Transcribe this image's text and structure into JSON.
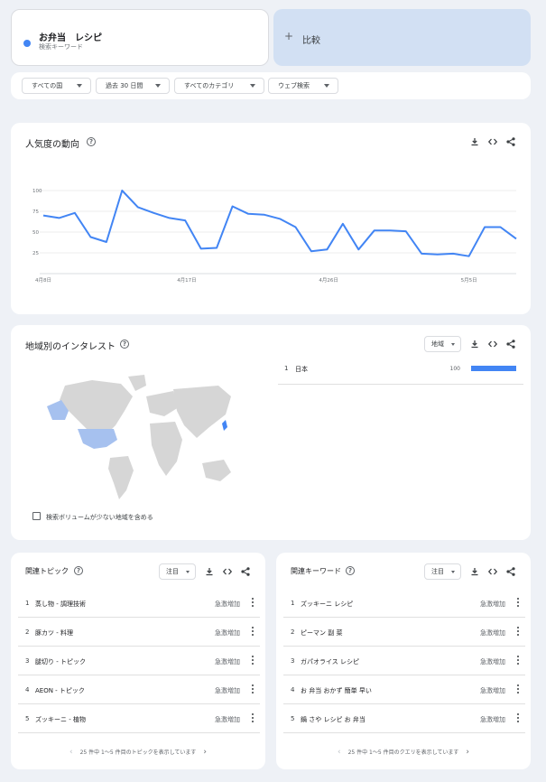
{
  "search_term": {
    "title": "お弁当　レシピ",
    "subtitle": "検索キーワード",
    "color": "#4285f4"
  },
  "compare": {
    "plus": "+",
    "label": "比較"
  },
  "filters": [
    "すべての国",
    "過去 30 日間",
    "すべてのカテゴリ",
    "ウェブ検索"
  ],
  "interest": {
    "title": "人気度の動向",
    "chart_data": {
      "type": "line",
      "series": [
        {
          "values": [
            70,
            67,
            73,
            44,
            38,
            100,
            80,
            73,
            67,
            64,
            30,
            31,
            81,
            72,
            71,
            66,
            56,
            27,
            29,
            60,
            29,
            52,
            52,
            51,
            24,
            23,
            24,
            21,
            56,
            56,
            42
          ]
        }
      ],
      "y_ticks": [
        "100",
        "75",
        "50",
        "25"
      ],
      "ylim": [
        0,
        100
      ],
      "x_ticks": [
        "4月8日",
        "4月17日",
        "4月26日",
        "5月5日"
      ],
      "color": "#4285f4",
      "grid": true
    }
  },
  "geo": {
    "title": "地域別のインタレスト",
    "level": "地域",
    "checkbox_label": "検索ボリュームが少ない地域を含める",
    "rows": [
      {
        "rank": "1",
        "name": "日本",
        "value": "100",
        "value_fraction": 1.0
      }
    ]
  },
  "topics": {
    "title": "関連トピック",
    "sort": "注目",
    "rows": [
      {
        "rank": "1",
        "label": "蒸し物 - 調理技術",
        "value": "急激増加"
      },
      {
        "rank": "2",
        "label": "豚カツ - 料理",
        "value": "急激増加"
      },
      {
        "rank": "3",
        "label": "腿切り - トピック",
        "value": "急激増加"
      },
      {
        "rank": "4",
        "label": "AEON - トピック",
        "value": "急激増加"
      },
      {
        "rank": "5",
        "label": "ズッキーニ - 植物",
        "value": "急激増加"
      }
    ],
    "pager": "25 件中 1～5 件目のトピックを表示しています"
  },
  "queries": {
    "title": "関連キーワード",
    "sort": "注目",
    "rows": [
      {
        "rank": "1",
        "label": "ズッキーニ レシピ",
        "value": "急激増加"
      },
      {
        "rank": "2",
        "label": "ピーマン 副 菜",
        "value": "急激増加"
      },
      {
        "rank": "3",
        "label": "ガパオライス レシピ",
        "value": "急激増加"
      },
      {
        "rank": "4",
        "label": "お 弁当 おかず 簡単 早い",
        "value": "急激増加"
      },
      {
        "rank": "5",
        "label": "鍋 さや レシピ お 弁当",
        "value": "急激増加"
      }
    ],
    "pager": "25 件中 1～5 件目のクエリを表示しています"
  },
  "icons": {
    "download": "download-icon",
    "embed": "embed-code-icon",
    "share": "share-icon",
    "help": "help-icon",
    "more": "more-vert-icon"
  }
}
